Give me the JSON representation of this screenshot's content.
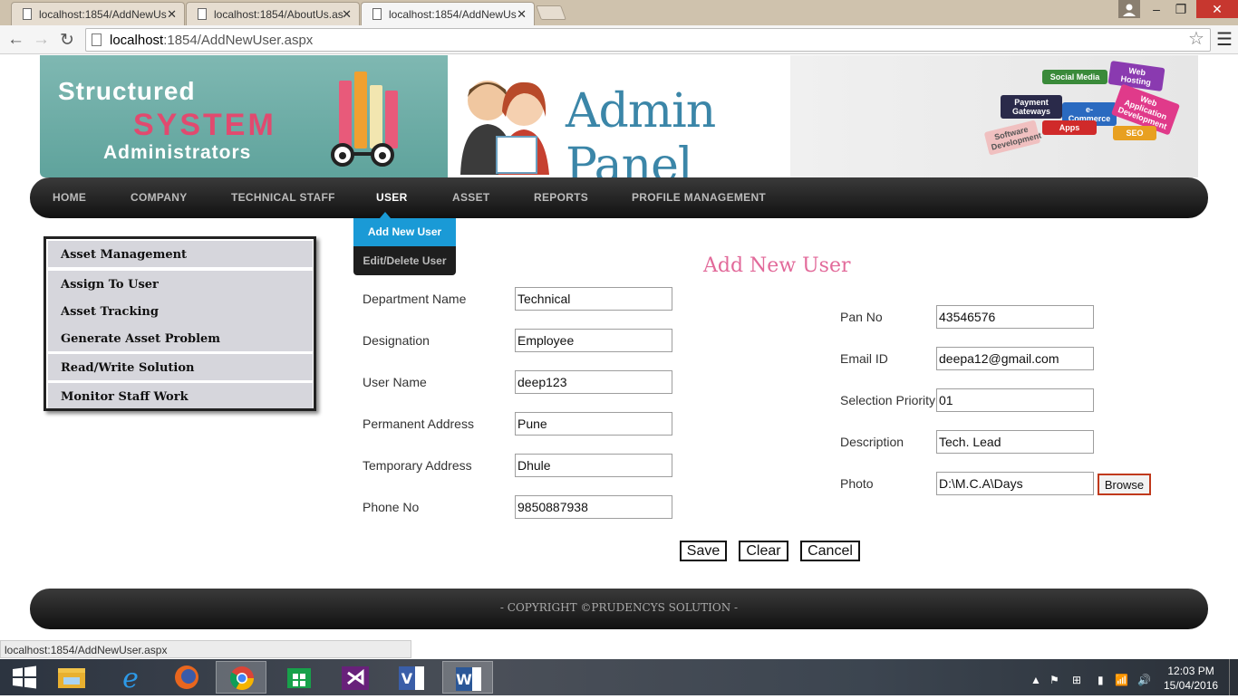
{
  "browser": {
    "tabs": [
      {
        "label": "localhost:1854/AddNewUs",
        "active": false
      },
      {
        "label": "localhost:1854/AboutUs.as",
        "active": false
      },
      {
        "label": "localhost:1854/AddNewUs",
        "active": true
      }
    ],
    "url_host": "localhost",
    "url_path": ":1854/AddNewUser.aspx",
    "status_url": "localhost:1854/AddNewUser.aspx"
  },
  "banner": {
    "line1": "Structured",
    "line2": "SYSTEM",
    "line3": "Administrators",
    "panel_title": "Admin Panel",
    "signs": [
      "Social Media",
      "Web Hosting",
      "Payment Gateways",
      "e-Commerce",
      "Web Application Development",
      "Apps",
      "SEO",
      "Software Development"
    ]
  },
  "nav": {
    "items": [
      "HOME",
      "COMPANY",
      "TECHNICAL STAFF",
      "USER",
      "ASSET",
      "REPORTS",
      "PROFILE MANAGEMENT"
    ],
    "active": "USER",
    "submenu": [
      "Add New User",
      "Edit/Delete User"
    ]
  },
  "sidebar": {
    "items": [
      "Asset Management",
      "Assign To User",
      "Asset Tracking",
      "Generate Asset Problem",
      "Read/Write Solution",
      "Monitor Staff Work"
    ]
  },
  "form": {
    "title": "Add New User",
    "left_fields": [
      {
        "label": "Department Name",
        "value": "Technical"
      },
      {
        "label": "Designation",
        "value": "Employee"
      },
      {
        "label": "User Name",
        "value": "deep123"
      },
      {
        "label": "Permanent Address",
        "value": "Pune"
      },
      {
        "label": "Temporary Address",
        "value": "Dhule"
      },
      {
        "label": "Phone No",
        "value": "9850887938"
      }
    ],
    "right_fields": [
      {
        "label": "Pan No",
        "value": "43546576"
      },
      {
        "label": "Email ID",
        "value": "deepa12@gmail.com"
      },
      {
        "label": "Selection Priority",
        "value": "01"
      },
      {
        "label": "Description",
        "value": "Tech. Lead"
      },
      {
        "label": "Photo",
        "value": "D:\\M.C.A\\Days"
      }
    ],
    "browse_label": "Browse",
    "buttons": {
      "save": "Save",
      "clear": "Clear",
      "cancel": "Cancel"
    }
  },
  "footer": {
    "text": "- COPYRIGHT ©PRUDENCYS SOLUTION -"
  },
  "taskbar": {
    "time": "12:03 PM",
    "date": "15/04/2016",
    "apps": [
      "start-icon",
      "file-explorer-icon",
      "internet-explorer-icon",
      "firefox-icon",
      "chrome-icon",
      "store-icon",
      "visual-studio-icon",
      "visio-icon",
      "word-icon"
    ],
    "active_app": "chrome-icon"
  }
}
